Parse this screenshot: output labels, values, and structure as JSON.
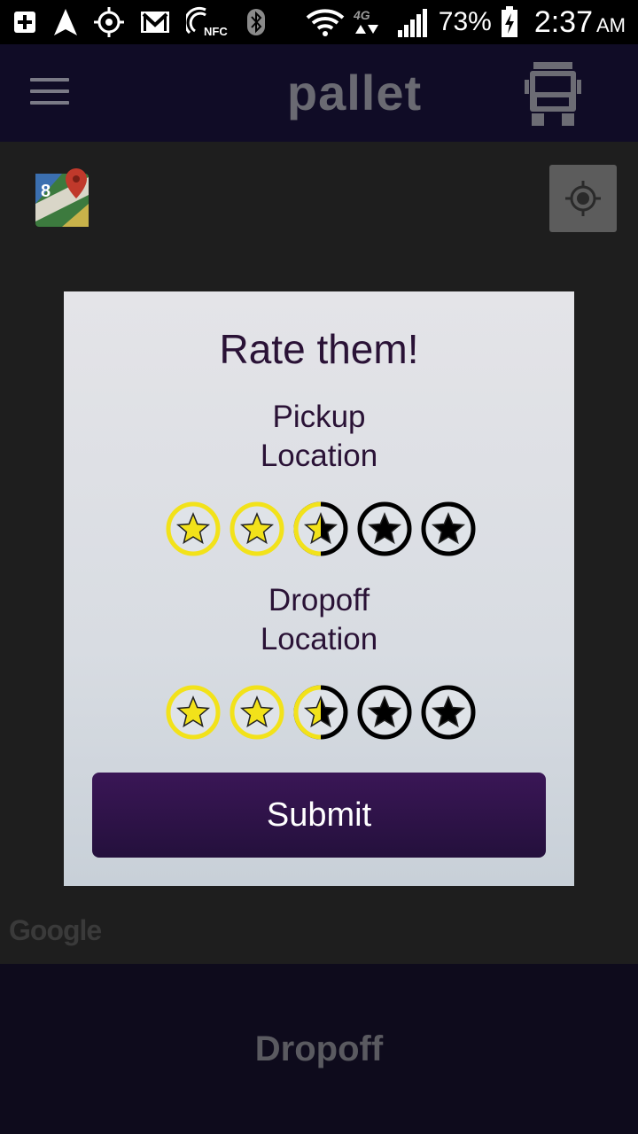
{
  "status_bar": {
    "icons": [
      "add-notification-icon",
      "navigation-arrow-icon",
      "gps-icon",
      "gmail-icon",
      "nfc-icon",
      "bluetooth-icon",
      "wifi-icon",
      "network-4g-icon",
      "signal-icon"
    ],
    "nfc_label": "NFC",
    "network_label": "4G",
    "battery": "73%",
    "time": "2:37",
    "ampm": "AM"
  },
  "app_bar": {
    "title": "pallet",
    "menu_icon": "hamburger-menu-icon",
    "action_icon": "truck-icon"
  },
  "map": {
    "attribution": "Google",
    "logo_icon": "google-maps-icon",
    "locate_icon": "my-location-icon"
  },
  "dialog": {
    "title": "Rate them!",
    "pickup_label_line1": "Pickup",
    "pickup_label_line2": "Location",
    "pickup_rating": 2.5,
    "dropoff_label_line1": "Dropoff",
    "dropoff_label_line2": "Location",
    "dropoff_rating": 2.5,
    "max_stars": 5,
    "submit_label": "Submit"
  },
  "bottom_bar": {
    "label": "Dropoff"
  },
  "colors": {
    "primary": "#2a1236",
    "star_filled": "#f2e21a",
    "star_empty": "#000000"
  }
}
